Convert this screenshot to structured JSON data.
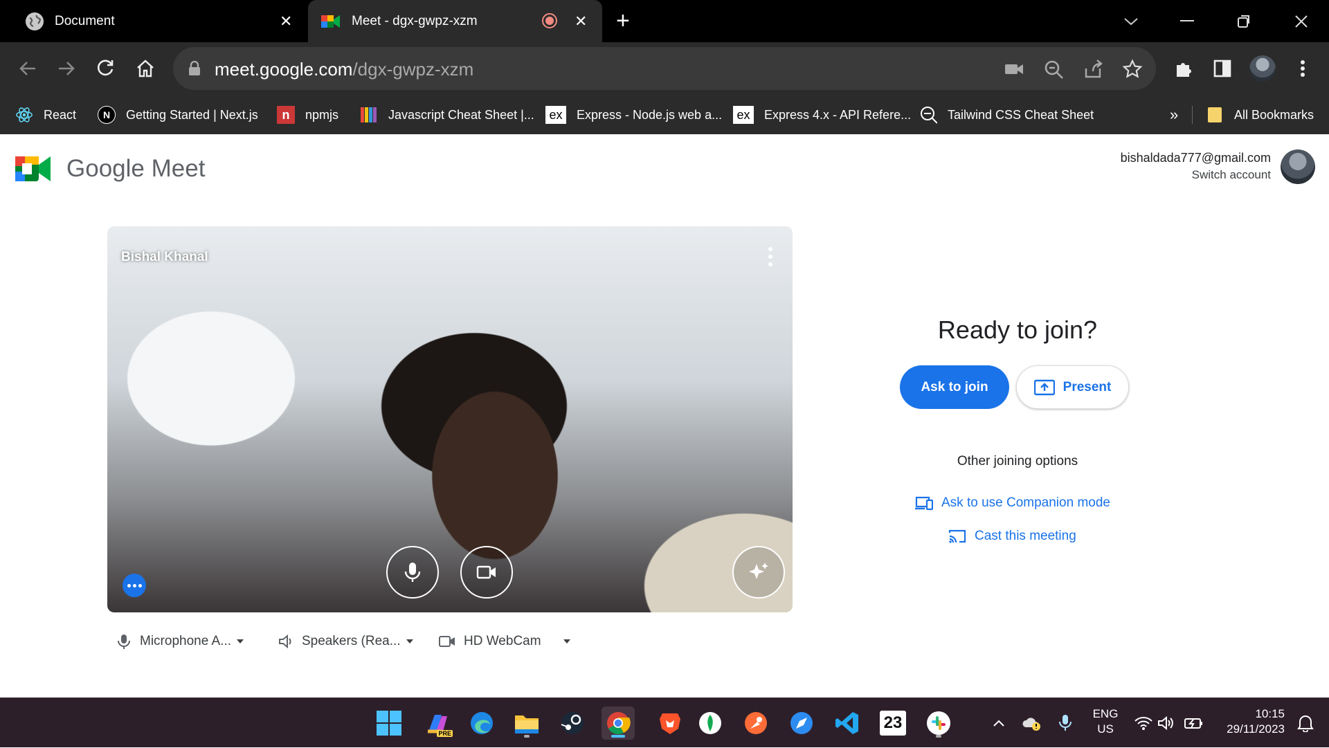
{
  "browser": {
    "tabs": [
      {
        "title": "Document",
        "close": "✕"
      },
      {
        "title": "Meet - dgx-gwpz-xzm",
        "close": "✕"
      }
    ],
    "new_tab": "+",
    "url_host": "meet.google.com",
    "url_path": "/dgx-gwpz-xzm",
    "bookmarks": [
      {
        "label": "React",
        "icon": "react-icon"
      },
      {
        "label": "Getting Started | Next.js",
        "icon": "nextjs-icon",
        "glyph": "N"
      },
      {
        "label": "npmjs",
        "icon": "npm-icon",
        "glyph": "n"
      },
      {
        "label": "Javascript Cheat Sheet |...",
        "icon": "stripes-icon"
      },
      {
        "label": "Express - Node.js web a...",
        "icon": "express-icon",
        "glyph": "ex"
      },
      {
        "label": "Express 4.x - API Refere...",
        "icon": "express-icon",
        "glyph": "ex"
      },
      {
        "label": "Tailwind CSS Cheat Sheet",
        "icon": "magnifier-icon"
      }
    ],
    "bookmarks_overflow": "»",
    "all_bookmarks": "All Bookmarks"
  },
  "meet": {
    "brand": {
      "google": "Google",
      "meet": "Meet"
    },
    "account": {
      "email": "bishaldada777@gmail.com",
      "switch": "Switch account"
    },
    "preview": {
      "name": "Bishal Khanal"
    },
    "devices": {
      "microphone": "Microphone A...",
      "speakers": "Speakers (Rea...",
      "camera": "HD WebCam"
    },
    "join": {
      "heading": "Ready to join?",
      "ask_button": "Ask to join",
      "present_button": "Present",
      "other_options": "Other joining options",
      "companion": "Ask to use Companion mode",
      "cast": "Cast this meeting"
    },
    "colors": {
      "accent": "#1a73e8"
    }
  },
  "taskbar": {
    "apps": [
      "windows-start",
      "copilot-pre",
      "edge",
      "file-explorer",
      "steam",
      "chrome",
      "brave",
      "mongodb-compass",
      "postman",
      "safari-like",
      "vscode",
      "calendar",
      "slack"
    ],
    "calendar_day": "23",
    "pre_badge": "PRE",
    "language": {
      "line1": "ENG",
      "line2": "US"
    },
    "clock": {
      "time": "10:15",
      "date": "29/11/2023"
    }
  }
}
